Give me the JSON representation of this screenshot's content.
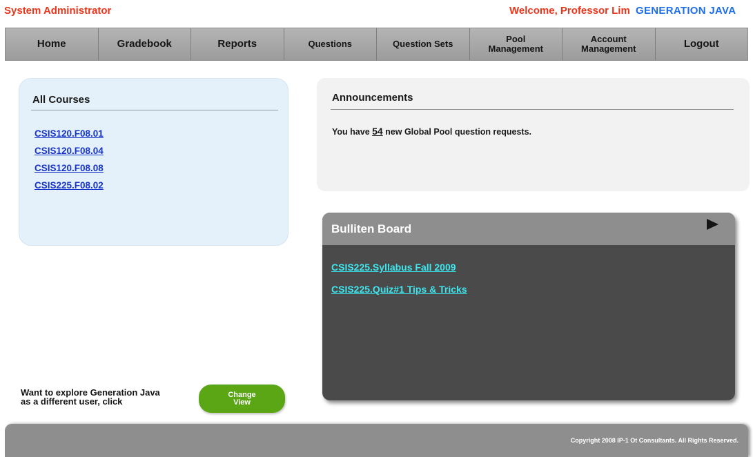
{
  "header": {
    "role": "System Administrator",
    "welcome": "Welcome, Professor Lim",
    "brand": "GENERATION JAVA"
  },
  "nav": [
    {
      "label": "Home"
    },
    {
      "label": "Gradebook"
    },
    {
      "label": "Reports"
    },
    {
      "label": "Questions"
    },
    {
      "label": "Question Sets"
    },
    {
      "label": "Pool\nManagement"
    },
    {
      "label": "Account\nManagement"
    },
    {
      "label": "Logout"
    }
  ],
  "courses": {
    "title": "All Courses",
    "items": [
      "CSIS120.F08.01",
      "CSIS120.F08.04",
      "CSIS120.F08.08",
      "CSIS225.F08.02"
    ]
  },
  "announcements": {
    "title": "Announcements",
    "prefix": "You have ",
    "count": "54",
    "suffix": " new Global Pool question requests."
  },
  "bulletin": {
    "title": "Bulliten Board",
    "links": [
      "CSIS225.Syllabus Fall 2009",
      "CSIS225.Quiz#1 Tips & Tricks"
    ]
  },
  "explore": {
    "text": "Want to explore Generation Java\nas a different user, click",
    "button": "Change\nView"
  },
  "footer": {
    "copyright": "Copyright 2008 IP-1 Ot Consultants. All Rights Reserved."
  },
  "colors": {
    "header_red": "#e8351a",
    "brand_blue": "#1e6ee8",
    "nav_gray": "#a8a8a8",
    "course_panel": "#e4f1fa",
    "link_blue": "#1733c8",
    "bulletin_bg": "#4a4a4a",
    "bulletin_link": "#3ee6ee",
    "button_green": "#5aa614"
  }
}
